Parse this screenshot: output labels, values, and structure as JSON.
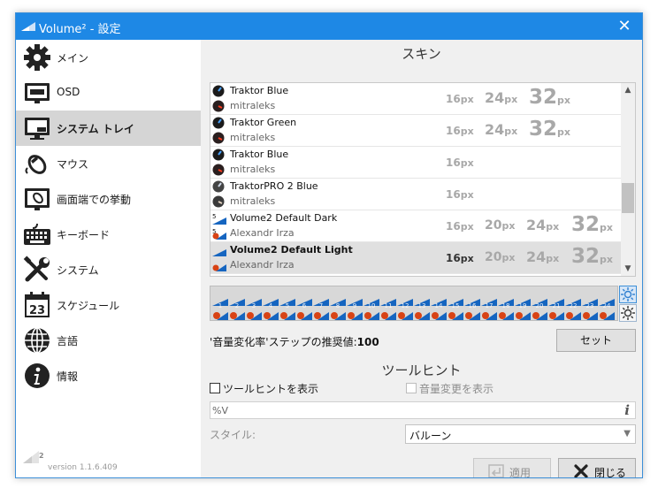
{
  "titlebar": {
    "title": "Volume² - 設定"
  },
  "sidebar": {
    "items": [
      {
        "label": "メイン",
        "icon": "gear-icon"
      },
      {
        "label": "OSD",
        "icon": "monitor-icon"
      },
      {
        "label": "システム トレイ",
        "icon": "system-tray-icon"
      },
      {
        "label": "マウス",
        "icon": "mouse-icon"
      },
      {
        "label": "画面端での挙動",
        "icon": "screen-edge-icon"
      },
      {
        "label": "キーボード",
        "icon": "keyboard-icon"
      },
      {
        "label": "システム",
        "icon": "tools-icon"
      },
      {
        "label": "スケジュール",
        "icon": "calendar-icon"
      },
      {
        "label": "言語",
        "icon": "globe-icon"
      },
      {
        "label": "情報",
        "icon": "info-icon"
      }
    ],
    "selected_index": 2,
    "calendar_day": "23",
    "footer": {
      "logo_number": "2",
      "version": "version 1.1.6.409"
    }
  },
  "skins": {
    "section_title": "スキン",
    "unit": "px",
    "rows": [
      {
        "name": "Traktor Blue",
        "author": "mitraleks",
        "sizes": [
          "16",
          "24",
          "32"
        ]
      },
      {
        "name": "Traktor Green",
        "author": "mitraleks",
        "sizes": [
          "16",
          "24",
          "32"
        ]
      },
      {
        "name": "Traktor Blue",
        "author": "mitraleks",
        "sizes": [
          "16"
        ]
      },
      {
        "name": "TraktorPRO 2 Blue",
        "author": "mitraleks",
        "sizes": [
          "16"
        ]
      },
      {
        "name": "Volume2 Default Dark",
        "author": "Alexandr Irza",
        "sizes": [
          "16",
          "20",
          "24",
          "32"
        ]
      },
      {
        "name": "Volume2 Default Light",
        "author": "Alexandr Irza",
        "sizes": [
          "16",
          "20",
          "24",
          "32"
        ]
      }
    ],
    "selected_index": 5
  },
  "preview": {
    "level_labels": [
      "1",
      "2",
      "3",
      "4",
      "5",
      "6",
      "7",
      "8",
      "9",
      "10",
      "11",
      "12",
      "13",
      "14",
      "15",
      "16",
      "17",
      "18",
      "19",
      "20",
      "21",
      "22",
      "23",
      "24"
    ]
  },
  "recommend": {
    "label": "'音量変化率'ステップの推奨値:",
    "value": "100",
    "set_button": "セット"
  },
  "tooltip": {
    "section_title": "ツールヒント",
    "show_tooltip_label": "ツールヒントを表示",
    "show_tooltip_checked": false,
    "show_volume_change_label": "音量変更を表示",
    "show_volume_change_checked": false,
    "format_value": "%V",
    "style_label": "スタイル:",
    "style_value": "バルーン"
  },
  "buttons": {
    "apply": "適用",
    "close": "閉じる"
  },
  "colors": {
    "titlebar": "#1e88e5",
    "accent": "#1565c0",
    "selected_nav": "#d5d5d5"
  }
}
